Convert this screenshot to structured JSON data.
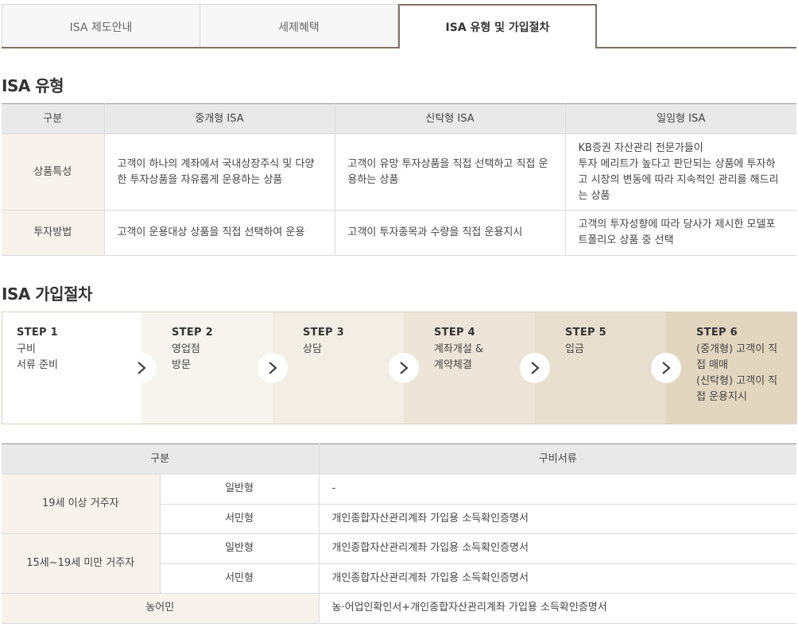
{
  "tabs": [
    {
      "label": "ISA 제도안내",
      "active": false
    },
    {
      "label": "세제혜택",
      "active": false
    },
    {
      "label": "ISA 유형 및 가입절차",
      "active": true
    }
  ],
  "section_types": {
    "title": "ISA 유형",
    "headers": [
      "구분",
      "중개형 ISA",
      "신탁형 ISA",
      "일임형 ISA"
    ],
    "rows": [
      {
        "label": "상품특성",
        "cells": [
          "고객이 하나의 계좌에서 국내상장주식 및 다양한 투자상품을 자유롭게 운용하는 상품",
          "고객이 유망 투자상품을 직접 선택하고 직접 운용하는 상품",
          "KB증권 자산관리 전문가들이\n투자 메리트가 높다고 판단되는 상품에 투자하고 시장의 변동에 따라 지속적인 관리를 해드리는 상품"
        ]
      },
      {
        "label": "투자방법",
        "cells": [
          "고객이 운용대상 상품을 직접 선택하여 운용",
          "고객이 투자종목과 수량을 직접 운용지시",
          "고객의 투자성향에 따라 당사가 제시한 모델포트폴리오 상품 중 선택"
        ]
      }
    ]
  },
  "section_process": {
    "title": "ISA 가입절차",
    "steps": [
      {
        "label": "STEP 1",
        "text": "구비\n서류 준비"
      },
      {
        "label": "STEP 2",
        "text": "영업점\n방문"
      },
      {
        "label": "STEP 3",
        "text": "상담"
      },
      {
        "label": "STEP 4",
        "text": "계좌개설 &\n계약체결"
      },
      {
        "label": "STEP 5",
        "text": "입금"
      },
      {
        "label": "STEP 6",
        "text": "(중개형) 고객이 직\n접 매매\n(신탁형) 고객이 직\n접 운용지시"
      }
    ]
  },
  "documents": {
    "headers": [
      "구분",
      "구비서류"
    ],
    "groups": [
      {
        "label": "19세 이상 거주자",
        "rows": [
          {
            "type": "일반형",
            "doc": "-"
          },
          {
            "type": "서민형",
            "doc": "개인종합자산관리계좌 가입용 소득확인증명서"
          }
        ]
      },
      {
        "label": "15세~19세 미만 거주자",
        "rows": [
          {
            "type": "일반형",
            "doc": "개인종합자산관리계좌 가입용 소득확인증명서"
          },
          {
            "type": "서민형",
            "doc": "개인종합자산관리계좌 가입용 소득확인증명서"
          }
        ]
      }
    ],
    "farmers": {
      "label": "농어민",
      "doc": "농·어업인확인서+개인종합자산관리계좌 가입용 소득확인증명서"
    }
  },
  "colors": {
    "accent_border": "#7d7268",
    "row_header_bg": "#f7f3ec",
    "header_bg": "#e9e9e9",
    "step_bg": [
      "#ffffff",
      "#f7f4ef",
      "#f2ede5",
      "#ede5d9",
      "#e8decf",
      "#e2d6c0"
    ]
  },
  "icons": {
    "step_arrow": "chevron-right-icon"
  }
}
